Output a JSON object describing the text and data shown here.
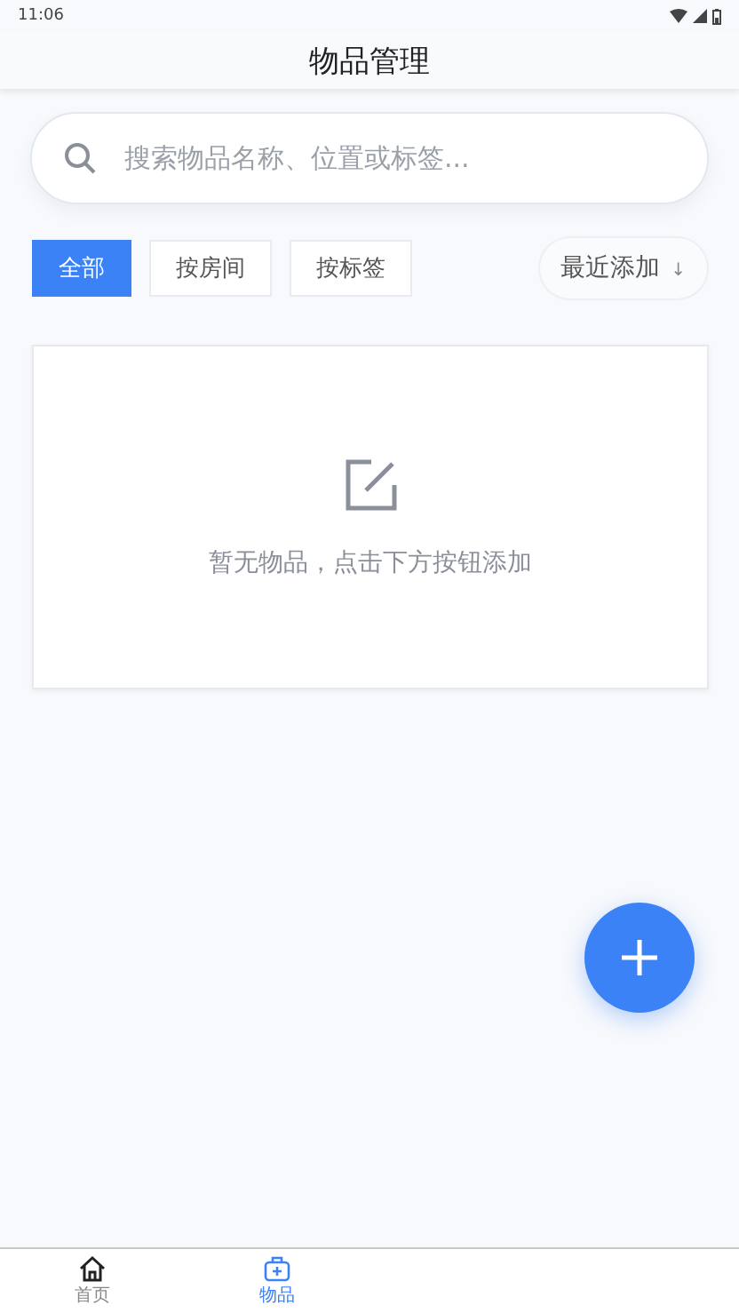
{
  "status_bar": {
    "time": "11:06"
  },
  "header": {
    "title": "物品管理"
  },
  "search": {
    "placeholder": "搜索物品名称、位置或标签..."
  },
  "filters": [
    {
      "label": "全部",
      "selected": true
    },
    {
      "label": "按房间",
      "selected": false
    },
    {
      "label": "按标签",
      "selected": false
    }
  ],
  "sort": {
    "label": "最近添加",
    "arrow": "↓"
  },
  "empty_state": {
    "message": "暂无物品，点击下方按钮添加"
  },
  "nav": [
    {
      "label": "首页",
      "kind": "home",
      "selected": false
    },
    {
      "label": "物品",
      "kind": "items",
      "selected": true
    }
  ]
}
